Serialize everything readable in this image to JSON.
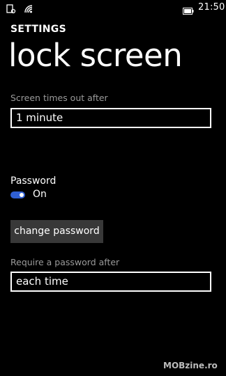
{
  "status_bar": {
    "time": "21:50",
    "icons": [
      "notification-icon",
      "wifi-icon",
      "battery-icon"
    ]
  },
  "header": {
    "section": "SETTINGS",
    "title": "lock screen"
  },
  "screen_timeout": {
    "label": "Screen times out after",
    "value": "1 minute"
  },
  "password": {
    "label": "Password",
    "toggle_state": "On",
    "toggle_on": true
  },
  "change_password_button": {
    "label": "change password"
  },
  "require_password": {
    "label": "Require a password after",
    "value": "each time"
  },
  "watermark": {
    "text": "MOBzine.ro"
  },
  "colors": {
    "background": "#000000",
    "accent": "#2f5fd4",
    "label_gray": "#9a9a9a",
    "button_bg": "#383838"
  }
}
